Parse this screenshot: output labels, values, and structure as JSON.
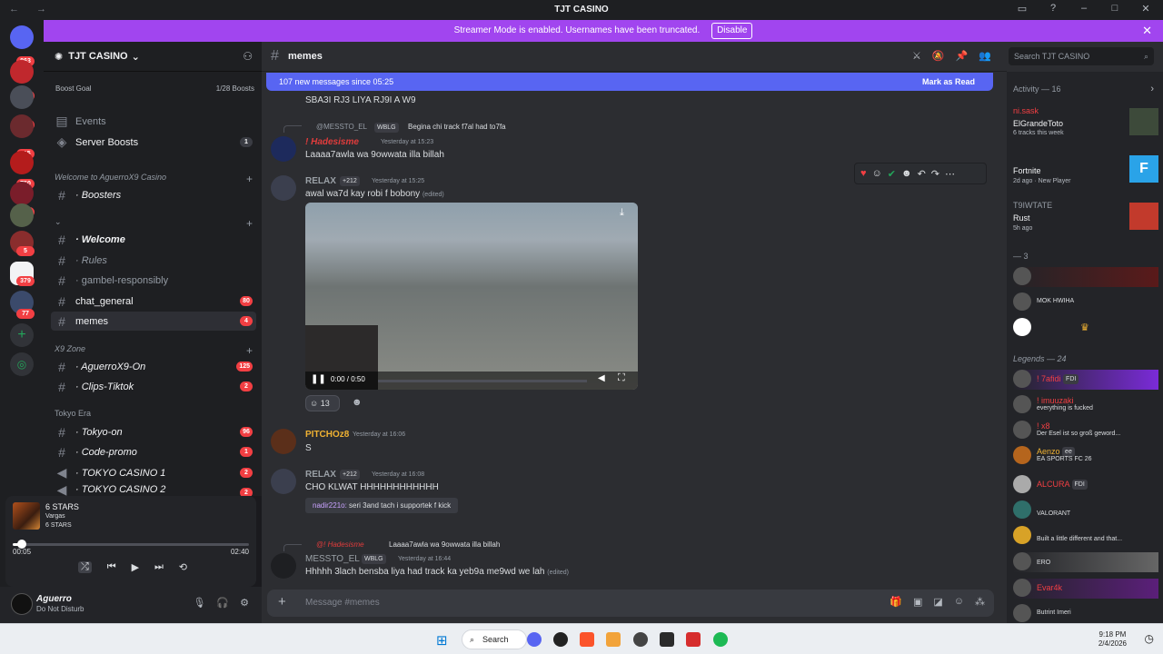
{
  "titlebar": {
    "title": "TJT CASINO",
    "nav": "← →"
  },
  "banner": {
    "text": "Streamer Mode is enabled. Usernames have been truncated.",
    "button": "Disable"
  },
  "guild_badges": [
    "863",
    "18",
    "48",
    "115",
    "750",
    "35",
    "5",
    "379",
    "77"
  ],
  "server": {
    "name": "TJT CASINO",
    "boost_goal": "Boost Goal",
    "boost_count": "1/28 Boosts",
    "events": "Events",
    "server_boosts": "Server Boosts",
    "server_boosts_badge": "1",
    "cat1": "Welcome to AguerroX9 Casino",
    "boosters": "· Boosters",
    "cat2": "⌄",
    "welcome": "· Welcome",
    "rules": "· Rules",
    "gambel": "· gambel-responsibly",
    "chat_general": "chat_general",
    "chat_general_badge": "80",
    "memes": "memes",
    "memes_badge": "4",
    "cat3": "X9 Zone",
    "aguerro_on": "· AguerroX9-On",
    "aguerro_on_badge": "125",
    "clips": "· Clips-Tiktok",
    "clips_badge": "2",
    "cat4": "Tokyo Era",
    "tokyo_on": "· Tokyo-on",
    "tokyo_on_badge": "96",
    "code_promo": "· Code-promo",
    "code_promo_badge": "1",
    "tokyo_casino": "· TOKYO CASINO 1",
    "tokyo_casino_badge": "2",
    "tokyo_casino2": "· TOKYO CASINO 2",
    "tokyo_casino2_badge": "2"
  },
  "player": {
    "title": "6 STARS",
    "artist": "Vargas",
    "album": "6 STARS",
    "elapsed": "00:05",
    "duration": "02:40",
    "progress_fraction": 0.03
  },
  "user": {
    "name": "Aguerro",
    "status": "Do Not Disturb"
  },
  "channel": {
    "name": "memes",
    "new_messages": "107 new messages since 05:25",
    "mark_as_read": "Mark as Read",
    "search_placeholder": "Search TJT CASINO",
    "composer_placeholder": "Message #memes"
  },
  "messages": {
    "m0_text": "SBA3I RJ3 LIYA RJ9I A W9",
    "m1_reply_user": "@MESSTO_EL",
    "m1_reply_tag": "WBLG",
    "m1_reply_text": "Begina chi track f7al had to7fa",
    "m1_author": "! Hadesisme",
    "m1_time": "Yesterday at 15:23",
    "m1_text": "Laaaa7awla wa 9owwata illa billah",
    "m2_author": "RELAX",
    "m2_tag": "+212",
    "m2_time": "Yesterday at 15:25",
    "m2_text": "awal wa7d kay robi f bobony",
    "m2_edited": "(edited)",
    "m2_video_time": "0:00 / 0:50",
    "m2_reaction_count": "13",
    "m3_author": "PITCHOz8",
    "m3_time": "Yesterday at 16:06",
    "m3_text": "S",
    "m4_author": "RELAX",
    "m4_tag": "+212",
    "m4_time": "Yesterday at 16:08",
    "m4_text": "CHO KLWAT HHHHHHHHHHHH",
    "m4_quote_user": "nadir221o:",
    "m4_quote_text": "seri 3and tach i supportek f kick",
    "m5_reply_user": "@! Hadesisme",
    "m5_reply_text": "Laaaa7awla wa 9owwata illa billah",
    "m5_author": "MESSTO_EL",
    "m5_tag": "WBLG",
    "m5_time": "Yesterday at 16:44",
    "m5_text": "Hhhhh 3lach bensba liya had track ka yeb9a me9wd we lah",
    "m5_edited": "(edited)"
  },
  "activity": {
    "title": "Activity — 16",
    "a1_name": "ni.sask",
    "a1_game": "ElGrandeToto",
    "a1_sub": "6 tracks this week",
    "a2_game": "Fortnite",
    "a2_sub": "2d ago · New Player",
    "a3_name": "T9IWTATE",
    "a3_game": "Rust",
    "a3_sub": "5h ago",
    "group3": "— 3",
    "mok": "MOK HWIHA",
    "legends": "Legends — 24",
    "l1_name": "! 7afidi",
    "l1_tag": "FDI",
    "l2_name": "! imuuzaki",
    "l2_sub": "everything is fucked",
    "l3_name": "! x8",
    "l3_sub": "Der Esel ist so groß geword...",
    "l4_name": "Aenzo",
    "l4_tag": "ee",
    "l4_sub": "EA SPORTS FC 26",
    "l5_name": "ALCURA",
    "l5_tag": "FDI",
    "l6_sub": "VALORANT",
    "l7_sub": "Built a little different and that...",
    "l8_sub": "ERO",
    "l9_name": "Evar4k",
    "l10_sub": "Butrint Imeri"
  },
  "taskbar": {
    "search": "Search",
    "time": "9:18 PM",
    "date": "2/4/2026"
  },
  "colors": {
    "blurple": "#5865f2",
    "streamer_banner": "#a145ef",
    "mention_red": "#f23f43",
    "author_relax": "#9aa0a6",
    "author_pitch": "#f0b232",
    "author_hades": "#e13c3c"
  }
}
